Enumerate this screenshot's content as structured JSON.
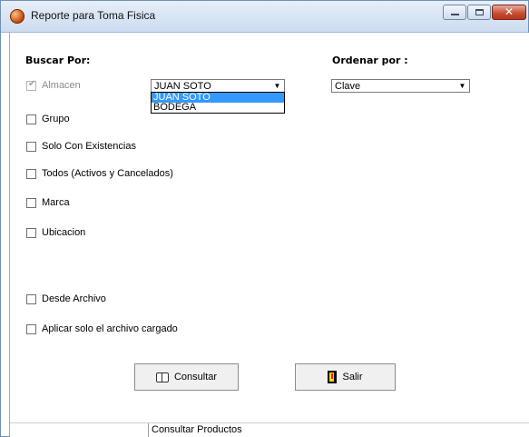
{
  "window": {
    "title": "Reporte para Toma Fisica"
  },
  "buscar_por": {
    "heading": "Buscar Por:",
    "almacen": {
      "label": "Almacen",
      "checked": true,
      "disabled": true,
      "selected": "JUAN SOTO",
      "options": [
        "JUAN SOTO",
        "BODEGA"
      ]
    },
    "checkboxes": [
      {
        "label": "Grupo",
        "checked": false
      },
      {
        "label": "Solo Con Existencias",
        "checked": false
      },
      {
        "label": "Todos (Activos y Cancelados)",
        "checked": false
      },
      {
        "label": "Marca",
        "checked": false
      },
      {
        "label": "Ubicacion",
        "checked": false
      },
      {
        "label": "Desde Archivo",
        "checked": false
      },
      {
        "label": "Aplicar solo el archivo cargado",
        "checked": false
      }
    ]
  },
  "ordenar_por": {
    "heading": "Ordenar por :",
    "selected": "Clave"
  },
  "buttons": {
    "consultar": {
      "label": "Consultar",
      "icon": "book-icon"
    },
    "salir": {
      "label": "Salir",
      "icon": "exit-door-icon"
    }
  },
  "status": {
    "pane1": "",
    "pane2": "Consultar Productos"
  },
  "colors": {
    "selection": "#3399ff",
    "close_button": "#c44b2e"
  }
}
